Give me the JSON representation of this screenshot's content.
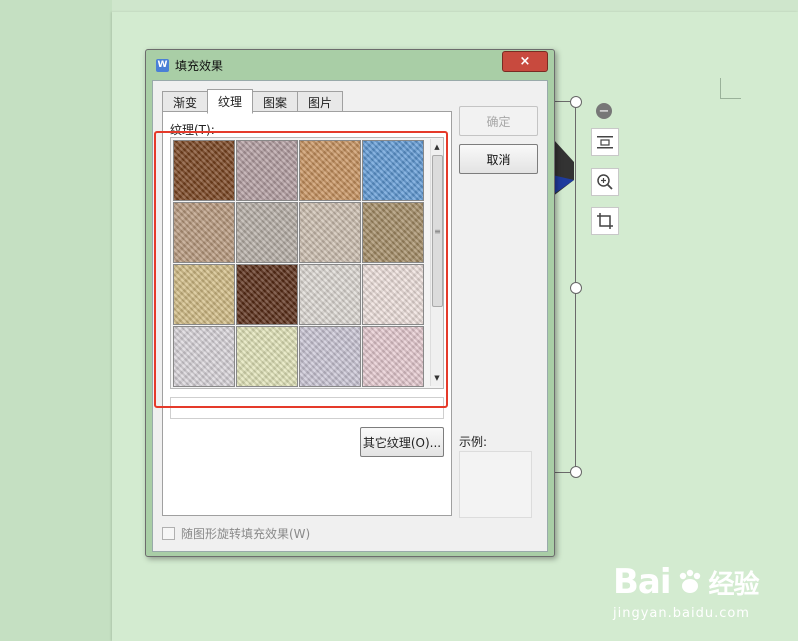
{
  "dialog": {
    "title": "填充效果",
    "app_icon_glyph": "W",
    "close_glyph": "×"
  },
  "tabs": [
    {
      "label": "渐变",
      "active": false
    },
    {
      "label": "纹理",
      "active": true
    },
    {
      "label": "图案",
      "active": false
    },
    {
      "label": "图片",
      "active": false
    }
  ],
  "texture": {
    "label": "纹理(T):",
    "other_button": "其它纹理(O)...",
    "swatches": [
      {
        "name": "brown-leather",
        "color": "#7a4420"
      },
      {
        "name": "woven-fiber",
        "color": "#b49ea2"
      },
      {
        "name": "burlap-weave",
        "color": "#c8925e"
      },
      {
        "name": "blue-canvas",
        "color": "#5f9ad6"
      },
      {
        "name": "sand-granite",
        "color": "#b99a7e"
      },
      {
        "name": "gray-granite",
        "color": "#b7afa7"
      },
      {
        "name": "beige-stone",
        "color": "#cdbfb0"
      },
      {
        "name": "brown-sand",
        "color": "#a58d66"
      },
      {
        "name": "gold-sand",
        "color": "#d2bc84"
      },
      {
        "name": "leopard-spots",
        "color": "#5a2d17"
      },
      {
        "name": "handwritten-paper",
        "color": "#ded9d4"
      },
      {
        "name": "pink-wood-stripes",
        "color": "#eee0dc"
      },
      {
        "name": "pastel-stripes",
        "color": "#d9d5da"
      },
      {
        "name": "yellow-mesh",
        "color": "#e2e4b8"
      },
      {
        "name": "lavender-cloth",
        "color": "#cbc6d6"
      },
      {
        "name": "pink-plaid",
        "color": "#e6cad0"
      }
    ],
    "scroll_up": "▲",
    "scroll_down": "▼",
    "scroll_grip": "≡"
  },
  "buttons": {
    "ok": "确定",
    "cancel": "取消"
  },
  "sample": {
    "label": "示例:"
  },
  "rotate_option": {
    "label": "随图形旋转填充效果(W)",
    "checked": false
  },
  "side_tools": {
    "collapse": "−"
  },
  "watermark": {
    "brand": "Bai",
    "brand_tail": "经验",
    "url": "jingyan.baidu.com"
  }
}
